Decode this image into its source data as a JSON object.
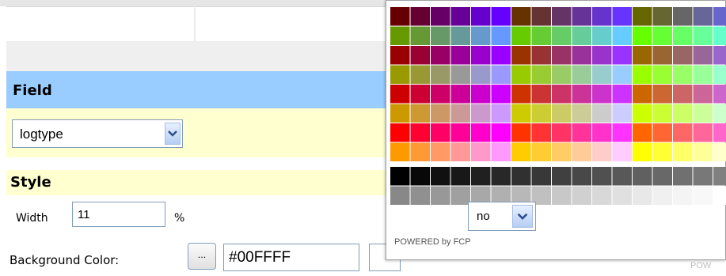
{
  "form": {
    "field_heading": "Field",
    "field_select_value": "logtype",
    "style_heading": "Style",
    "width_label": "Width",
    "width_value": "11",
    "width_unit": "%",
    "bg_label": "Background Color:",
    "picker_button_label": "...",
    "bg_color_value": "#00FFFF"
  },
  "color_picker": {
    "websafe_select_value": "no",
    "powered_by": "POWERED by FCP",
    "partial_footer_text": "POW",
    "palette_rows": [
      [
        "#660000",
        "#660033",
        "#660066",
        "#660099",
        "#6600CC",
        "#6600FF",
        "#663300",
        "#663333",
        "#663366",
        "#663399",
        "#6633CC",
        "#6633FF",
        "#666600",
        "#666633",
        "#666666",
        "#666699",
        "#6666CC"
      ],
      [
        "#669900",
        "#669933",
        "#669966",
        "#669999",
        "#6699CC",
        "#6699FF",
        "#66CC00",
        "#66CC33",
        "#66CC66",
        "#66CC99",
        "#66CCCC",
        "#66CCFF",
        "#66FF00",
        "#66FF33",
        "#66FF66",
        "#66FF99",
        "#66FFCC"
      ],
      [
        "#990000",
        "#990033",
        "#990066",
        "#990099",
        "#9900CC",
        "#9900FF",
        "#993300",
        "#993333",
        "#993366",
        "#993399",
        "#9933CC",
        "#9933FF",
        "#996600",
        "#996633",
        "#996666",
        "#996699",
        "#9966CC"
      ],
      [
        "#999900",
        "#999933",
        "#999966",
        "#999999",
        "#9999CC",
        "#9999FF",
        "#99CC00",
        "#99CC33",
        "#99CC66",
        "#99CC99",
        "#99CCCC",
        "#99CCFF",
        "#99FF00",
        "#99FF33",
        "#99FF66",
        "#99FF99",
        "#99FFCC"
      ],
      [
        "#CC0000",
        "#CC0033",
        "#CC0066",
        "#CC0099",
        "#CC00CC",
        "#CC00FF",
        "#CC3300",
        "#CC3333",
        "#CC3366",
        "#CC3399",
        "#CC33CC",
        "#CC33FF",
        "#CC6600",
        "#CC6633",
        "#CC6666",
        "#CC6699",
        "#CC66CC"
      ],
      [
        "#CC9900",
        "#CC9933",
        "#CC9966",
        "#CC9999",
        "#CC99CC",
        "#CC99FF",
        "#CCCC00",
        "#CCCC33",
        "#CCCC66",
        "#CCCC99",
        "#CCCCCC",
        "#CCCCFF",
        "#CCFF00",
        "#CCFF33",
        "#CCFF66",
        "#CCFF99",
        "#CCFFCC"
      ],
      [
        "#FF0000",
        "#FF0033",
        "#FF0066",
        "#FF0099",
        "#FF00CC",
        "#FF00FF",
        "#FF3300",
        "#FF3333",
        "#FF3366",
        "#FF3399",
        "#FF33CC",
        "#FF33FF",
        "#FF6600",
        "#FF6633",
        "#FF6666",
        "#FF6699",
        "#FF66CC"
      ],
      [
        "#FF9900",
        "#FF9933",
        "#FF9966",
        "#FF9999",
        "#FF99CC",
        "#FF99FF",
        "#FFCC00",
        "#FFCC33",
        "#FFCC66",
        "#FFCC99",
        "#FFCCCC",
        "#FFCCFF",
        "#FFFF00",
        "#FFFF33",
        "#FFFF66",
        "#FFFF99",
        "#FFFFCC"
      ],
      [
        "#000000",
        "#080808",
        "#101010",
        "#181818",
        "#202020",
        "#282828",
        "#303030",
        "#383838",
        "#404040",
        "#484848",
        "#505050",
        "#585858",
        "#606060",
        "#686868",
        "#707070",
        "#787878",
        "#808080"
      ],
      [
        "#888888",
        "#909090",
        "#989898",
        "#A0A0A0",
        "#A8A8A8",
        "#B0B0B0",
        "#B8B8B8",
        "#C0C0C0",
        "#C8C8C8",
        "#D0D0D0",
        "#D8D8D8",
        "#E0E0E0",
        "#E8E8E8",
        "#F0F0F0",
        "#F4F4F4",
        "#F8F8F8",
        "#FFFFFF"
      ]
    ]
  },
  "icons": {
    "dropdown_arrow": "chevron-down-icon",
    "ellipsis_button": "ellipsis-icon"
  }
}
